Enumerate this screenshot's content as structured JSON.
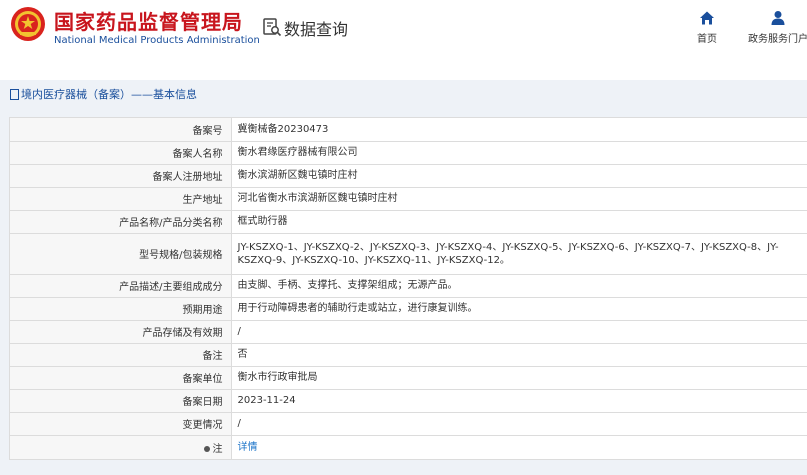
{
  "header": {
    "title_cn": "国家药品监督管理局",
    "title_en": "National Medical Products Administration",
    "query_title": "数据查询",
    "nav": [
      {
        "label": "首页",
        "icon": "home-icon"
      },
      {
        "label": "政务服务门户",
        "icon": "user-icon"
      }
    ]
  },
  "breadcrumb": {
    "text": "境内医疗器械（备案）——基本信息"
  },
  "record": {
    "rows": [
      {
        "label": "备案号",
        "value": "冀衡械备20230473"
      },
      {
        "label": "备案人名称",
        "value": "衡水君缘医疗器械有限公司"
      },
      {
        "label": "备案人注册地址",
        "value": "衡水滨湖新区魏屯镇时庄村"
      },
      {
        "label": "生产地址",
        "value": "河北省衡水市滨湖新区魏屯镇时庄村"
      },
      {
        "label": "产品名称/产品分类名称",
        "value": "框式助行器"
      },
      {
        "label": "型号规格/包装规格",
        "value": "JY-KSZXQ-1、JY-KSZXQ-2、JY-KSZXQ-3、JY-KSZXQ-4、JY-KSZXQ-5、JY-KSZXQ-6、JY-KSZXQ-7、JY-KSZXQ-8、JY-KSZXQ-9、JY-KSZXQ-10、JY-KSZXQ-11、JY-KSZXQ-12。"
      },
      {
        "label": "产品描述/主要组成成分",
        "value": "由支脚、手柄、支撑托、支撑架组成；无源产品。"
      },
      {
        "label": "预期用途",
        "value": "用于行动障碍患者的辅助行走或站立，进行康复训练。"
      },
      {
        "label": "产品存储及有效期",
        "value": "/"
      },
      {
        "label": "备注",
        "value": "否"
      },
      {
        "label": "备案单位",
        "value": "衡水市行政审批局"
      },
      {
        "label": "备案日期",
        "value": "2023-11-24"
      },
      {
        "label": "变更情况",
        "value": "/"
      },
      {
        "label": "注",
        "value": "详情"
      }
    ]
  }
}
